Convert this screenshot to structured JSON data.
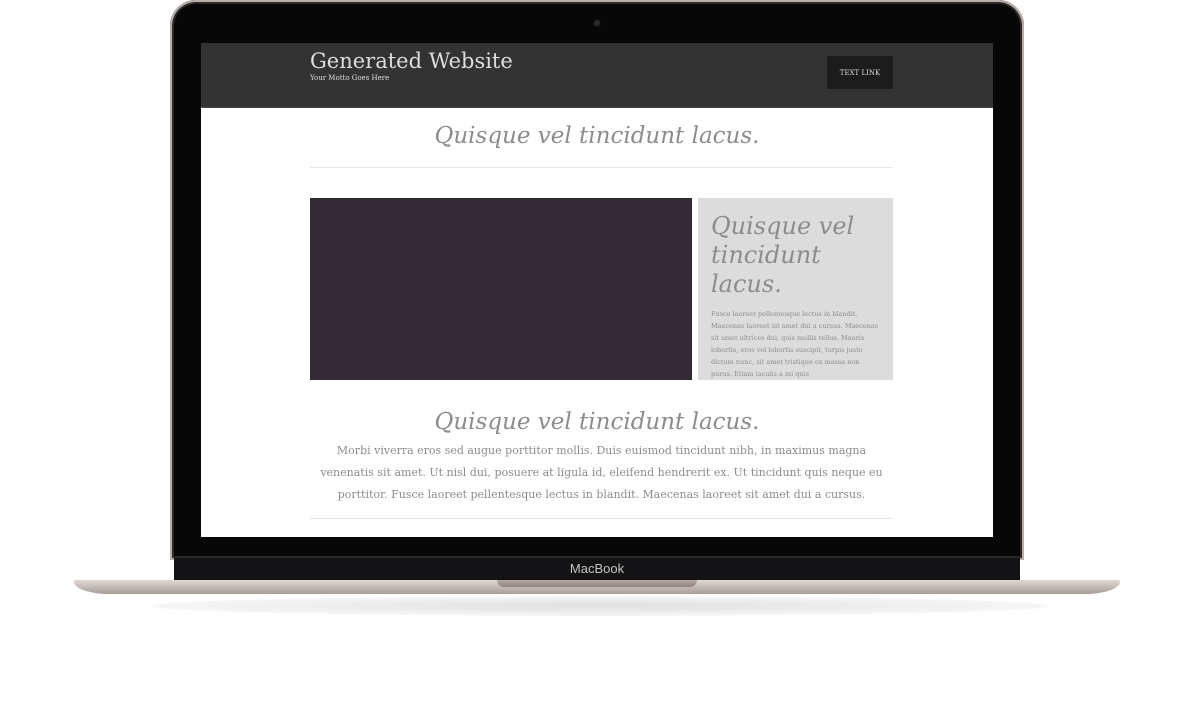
{
  "device": {
    "brand_label": "MacBook"
  },
  "site": {
    "title": "Generated Website",
    "motto": "Your Motto Goes Here",
    "nav_link": "TEXT LINK"
  },
  "content": {
    "top_heading": "Quisque vel tincidunt lacus.",
    "side_heading": "Quisque vel tincidunt lacus.",
    "side_body": "Fusce laoreet pellentesque lectus in blandit. Maecenas laoreet sit amet dui a cursus. Maecenas sit amet ultrices dui, quis mollis tellus. Mauris lobortis, eros vel lobortis suscipit, turpis justo dictum nunc, sit amet tristique ex massa non purus. Etiam iaculis a mi quis",
    "mid_heading": "Quisque vel tincidunt lacus.",
    "paragraph": "Morbi viverra eros sed augue porttitor mollis. Duis euismod tincidunt nibh, in maximus magna venenatis sit amet. Ut nisl dui, posuere at ligula id, eleifend hendrerit ex. Ut tincidunt quis neque eu porttitor. Fusce laoreet pellentesque lectus in blandit. Maecenas laoreet sit amet dui a cursus."
  },
  "colors": {
    "header_bg": "#333333",
    "hero_box": "#312a33",
    "side_box": "#dcdcdc",
    "muted_text": "#8c8c8c"
  }
}
